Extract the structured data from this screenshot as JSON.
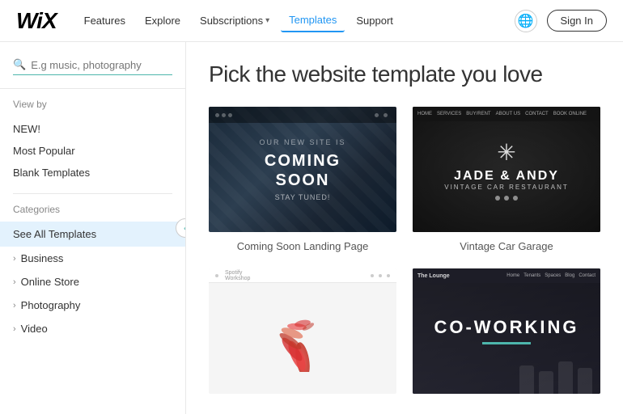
{
  "header": {
    "logo": "WiX",
    "nav": [
      {
        "label": "Features",
        "active": false
      },
      {
        "label": "Explore",
        "active": false
      },
      {
        "label": "Subscriptions",
        "active": false,
        "hasDropdown": true
      },
      {
        "label": "Templates",
        "active": true
      },
      {
        "label": "Support",
        "active": false
      }
    ],
    "globe_label": "🌐",
    "signin_label": "Sign In"
  },
  "sidebar": {
    "collapse_icon": "‹",
    "search_placeholder": "E.g music, photography",
    "view_by_label": "View by",
    "view_by_links": [
      {
        "label": "NEW!"
      },
      {
        "label": "Most Popular"
      },
      {
        "label": "Blank Templates"
      }
    ],
    "categories_label": "Categories",
    "all_templates_label": "See All Templates",
    "category_links": [
      {
        "label": "Business"
      },
      {
        "label": "Online Store"
      },
      {
        "label": "Photography"
      },
      {
        "label": "Video"
      }
    ]
  },
  "content": {
    "page_title": "Pick the website template you love",
    "templates": [
      {
        "id": "coming-soon",
        "name": "Coming Soon Landing Page",
        "thumb_type": "coming-soon"
      },
      {
        "id": "vintage-car",
        "name": "Vintage Car Garage",
        "thumb_type": "vintage"
      },
      {
        "id": "sculpture",
        "name": "",
        "thumb_type": "sculpture"
      },
      {
        "id": "coworking",
        "name": "",
        "thumb_type": "coworking"
      }
    ]
  }
}
